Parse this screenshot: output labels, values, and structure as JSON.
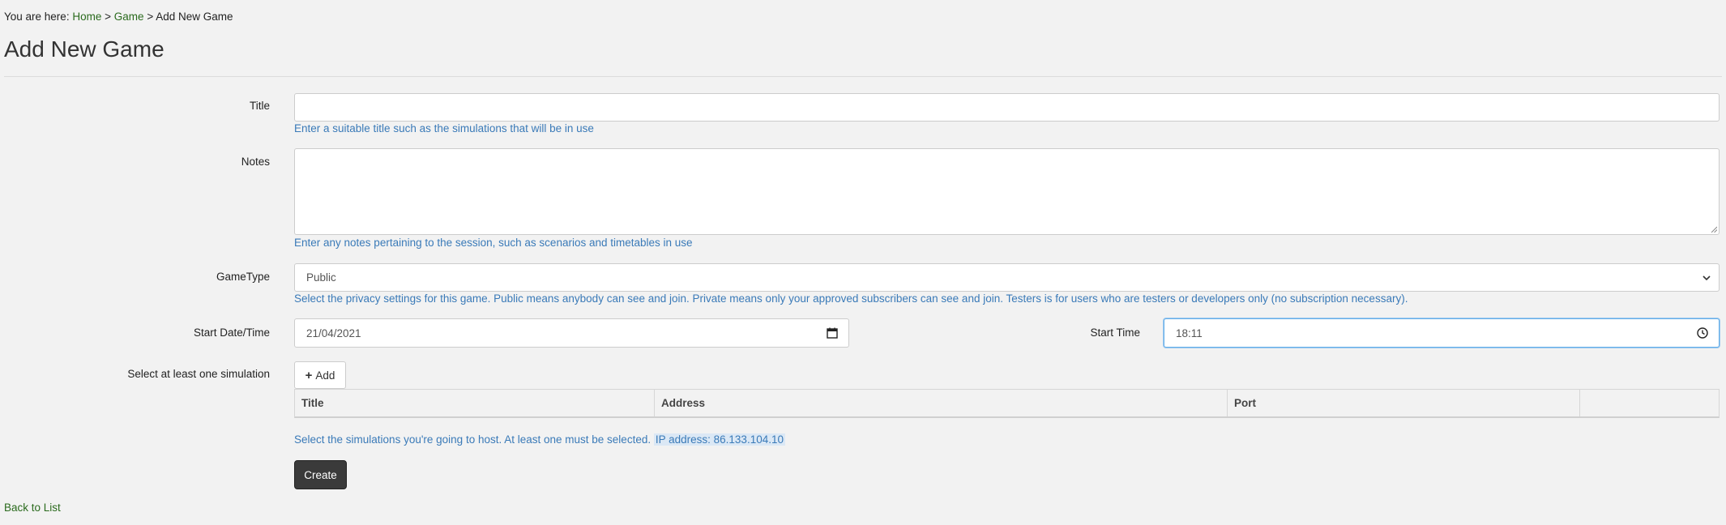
{
  "breadcrumb": {
    "prefix": "You are here:",
    "home": "Home",
    "separator": ">",
    "game": "Game",
    "current": "Add New Game"
  },
  "page": {
    "title": "Add New Game"
  },
  "form": {
    "title": {
      "label": "Title",
      "value": "",
      "help": "Enter a suitable title such as the simulations that will be in use"
    },
    "notes": {
      "label": "Notes",
      "value": "",
      "help": "Enter any notes pertaining to the session, such as scenarios and timetables in use"
    },
    "game_type": {
      "label": "GameType",
      "selected": "Public",
      "help": "Select the privacy settings for this game. Public means anybody can see and join. Private means only your approved subscribers can see and join. Testers is for users who are testers or developers only (no subscription necessary)."
    },
    "start_date": {
      "label": "Start Date/Time",
      "value": "21/04/2021"
    },
    "start_time": {
      "label": "Start Time",
      "value": "18:11"
    },
    "simulations": {
      "label": "Select at least one simulation",
      "add_label": "Add",
      "columns": [
        "Title",
        "Address",
        "Port",
        ""
      ],
      "help": "Select the simulations you're going to host. At least one must be selected.",
      "ip": "IP address: 86.133.104.10"
    },
    "create_label": "Create"
  },
  "footer": {
    "back_label": "Back to List"
  },
  "colors": {
    "background": "#f2f2f2",
    "link": "#2a6a1d",
    "help_text": "#3a7ab8",
    "button_dark": "#3a3a3a"
  }
}
